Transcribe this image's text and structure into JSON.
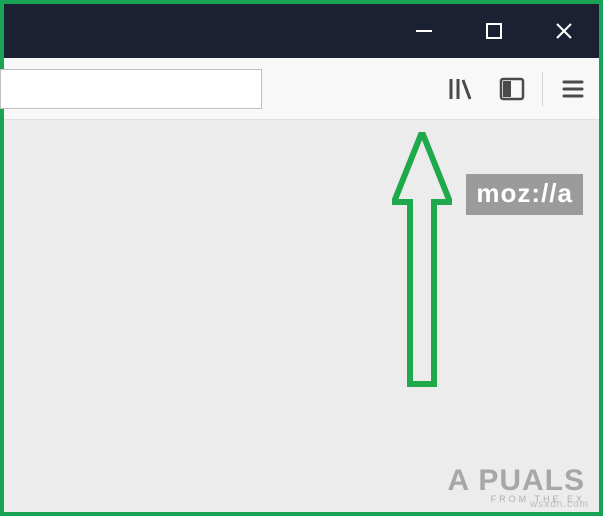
{
  "window": {
    "minimize_label": "Minimize",
    "maximize_label": "Maximize",
    "close_label": "Close"
  },
  "toolbar": {
    "address_value": "",
    "address_placeholder": "",
    "library_label": "Library",
    "sidebar_label": "Sidebars",
    "menu_label": "Open menu"
  },
  "content": {
    "mozilla_badge": "moz://a"
  },
  "watermark": {
    "brand": "A  PUALS",
    "sub": "FROM  THE  EX",
    "url": "wsxdn.com"
  }
}
